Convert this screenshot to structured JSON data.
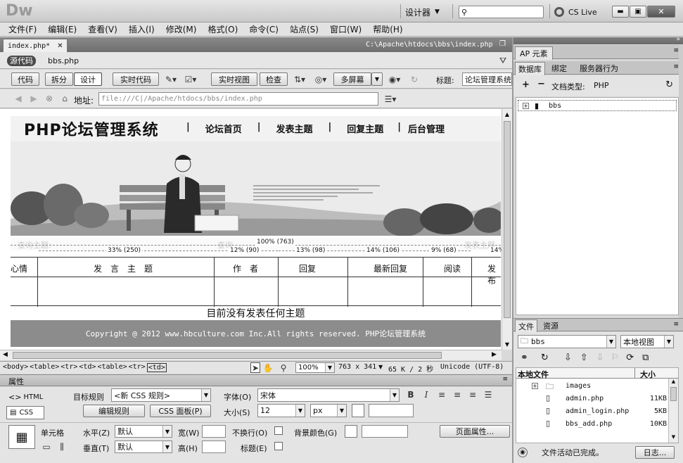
{
  "app": {
    "logo": "Dw",
    "workspace": "设计器",
    "cslive": "CS Live"
  },
  "menu": [
    "文件(F)",
    "编辑(E)",
    "查看(V)",
    "插入(I)",
    "修改(M)",
    "格式(O)",
    "命令(C)",
    "站点(S)",
    "窗口(W)",
    "帮助(H)"
  ],
  "doc": {
    "tab": "index.php*",
    "path": "C:\\Apache\\htdocs\\bbs\\index.php",
    "source_label": "源代码",
    "related_file": "bbs.php"
  },
  "toolbar": {
    "code": "代码",
    "split": "拆分",
    "design": "设计",
    "live_code": "实时代码",
    "live_view": "实时视图",
    "inspect": "检查",
    "multiscreen": "多屏幕",
    "title_label": "标题:",
    "title_value": "论坛管理系统"
  },
  "address": {
    "label": "地址:",
    "value": "file:///C|/Apache/htdocs/bbs/index.php"
  },
  "page": {
    "site_title": "PHP论坛管理系统",
    "nav": [
      "论坛首页",
      "发表主题",
      "回复主题",
      "后台管理"
    ],
    "hint_left": "查询主题:",
    "hint_mid": "查询",
    "hint_right": "发表主题",
    "width_total": "100% (763)",
    "widths": [
      "33% (250)",
      "12% (90)",
      "13% (98)",
      "14% (106)",
      "9% (68)",
      "14%"
    ],
    "headers": [
      "心情",
      "发　言　主　题",
      "作　者",
      "回复",
      "最新回复",
      "阅读",
      "发布"
    ],
    "empty_msg": "目前没有发表任何主题",
    "copyright": "Copyright @ 2012 www.hbculture.com Inc.All rights reserved. PHP论坛管理系统"
  },
  "status": {
    "tags": [
      "<body>",
      "<table>",
      "<tr>",
      "<td>",
      "<table>",
      "<tr>",
      "<td>"
    ],
    "zoom": "100%",
    "size": "763 x 341",
    "filesize": "65 K / 2 秒",
    "encoding": "Unicode (UTF-8)"
  },
  "props": {
    "title": "属性",
    "html": "HTML",
    "css": "CSS",
    "target_rule_label": "目标规则",
    "target_rule": "<新 CSS 规则>",
    "edit_rule": "编辑规则",
    "css_panel": "CSS 面板(P)",
    "font_label": "字体(O)",
    "font": "宋体",
    "size_label": "大小(S)",
    "size": "12",
    "unit": "px",
    "cell_label": "单元格",
    "horz_label": "水平(Z)",
    "horz": "默认",
    "vert_label": "垂直(T)",
    "vert": "默认",
    "width_label": "宽(W)",
    "height_label": "高(H)",
    "nowrap_label": "不换行(O)",
    "header_label": "标题(E)",
    "bg_label": "背景颜色(G)",
    "page_props": "页面属性..."
  },
  "right": {
    "ap_tab": "AP 元素",
    "tabs": [
      "数据库",
      "绑定",
      "服务器行为"
    ],
    "doc_type_label": "文档类型:",
    "doc_type": "PHP",
    "db_item": "bbs",
    "files_tabs": [
      "文件",
      "资源"
    ],
    "site": "bbs",
    "view": "本地视图",
    "col_local": "本地文件",
    "col_size": "大小",
    "files": [
      {
        "name": "images",
        "size": ""
      },
      {
        "name": "admin.php",
        "size": "11KB"
      },
      {
        "name": "admin_login.php",
        "size": "5KB"
      },
      {
        "name": "bbs_add.php",
        "size": "10KB"
      }
    ],
    "file_status": "文件活动已完成。",
    "log": "日志..."
  }
}
